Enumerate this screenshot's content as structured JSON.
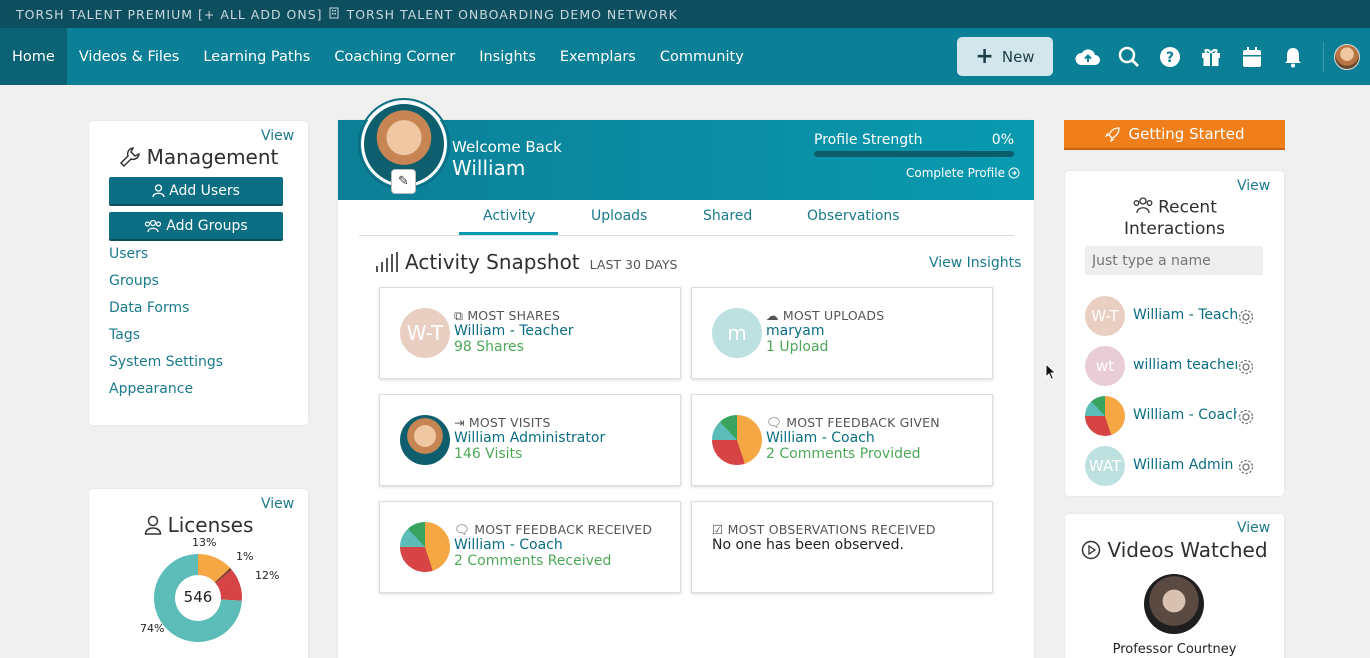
{
  "topbar": {
    "account": "TORSH TALENT PREMIUM [+ ALL ADD ONS]",
    "network": "TORSH TALENT ONBOARDING DEMO NETWORK"
  },
  "nav": {
    "items": [
      "Home",
      "Videos & Files",
      "Learning Paths",
      "Coaching Corner",
      "Insights",
      "Exemplars",
      "Community"
    ],
    "new_label": "New",
    "icons": [
      "upload-cloud-icon",
      "search-icon",
      "help-icon",
      "gift-icon",
      "calendar-icon",
      "bell-icon"
    ]
  },
  "management": {
    "view": "View",
    "title": "Management",
    "add_users": "Add Users",
    "add_groups": "Add Groups",
    "links": [
      "Users",
      "Groups",
      "Data Forms",
      "Tags",
      "System Settings",
      "Appearance"
    ]
  },
  "licenses": {
    "view": "View",
    "title": "Licenses",
    "total": "546",
    "segments": [
      {
        "label": "74%",
        "value": 74,
        "color": "#5bbcb8"
      },
      {
        "label": "13%",
        "value": 13,
        "color": "#f4a742"
      },
      {
        "label": "1%",
        "value": 1,
        "color": "#8a3f2e"
      },
      {
        "label": "12%",
        "value": 12,
        "color": "#d74446"
      }
    ]
  },
  "profile": {
    "welcome": "Welcome Back",
    "name": "William",
    "strength_label": "Profile Strength",
    "strength_value": "0%",
    "strength_fraction": 0,
    "complete": "Complete Profile"
  },
  "tabs": [
    "Activity",
    "Uploads",
    "Shared",
    "Observations"
  ],
  "snapshot": {
    "title": "Activity Snapshot",
    "period": "LAST 30 DAYS",
    "view_insights": "View Insights",
    "cards": [
      {
        "label": "MOST SHARES",
        "name": "William - Teacher",
        "value": "98 Shares",
        "avatar": "W-T"
      },
      {
        "label": "MOST UPLOADS",
        "name": "maryam",
        "value": "1 Upload",
        "avatar": "m"
      },
      {
        "label": "MOST VISITS",
        "name": "William Administrator",
        "value": "146 Visits"
      },
      {
        "label": "MOST FEEDBACK GIVEN",
        "name": "William - Coach",
        "value": "2 Comments Provided"
      },
      {
        "label": "MOST FEEDBACK RECEIVED",
        "name": "William - Coach",
        "value": "2 Comments Received"
      },
      {
        "label": "MOST OBSERVATIONS RECEIVED",
        "value": "No one has been observed."
      }
    ]
  },
  "getting_started": "Getting Started",
  "recent": {
    "view": "View",
    "title_line1": "Recent",
    "title_line2": "Interactions",
    "placeholder": "Just type a name",
    "people": [
      {
        "initials": "W-T",
        "name": "William - Teacher",
        "color": "#e8cfc2"
      },
      {
        "initials": "wt",
        "name": "william teachera",
        "color": "#e8cdd6"
      },
      {
        "initials": "",
        "name": "William - Coach",
        "color": ""
      },
      {
        "initials": "WAT",
        "name": "William Admin Te",
        "color": "#bde0e0"
      }
    ]
  },
  "videos": {
    "view": "View",
    "title": "Videos Watched",
    "person": "Professor Courtney"
  }
}
